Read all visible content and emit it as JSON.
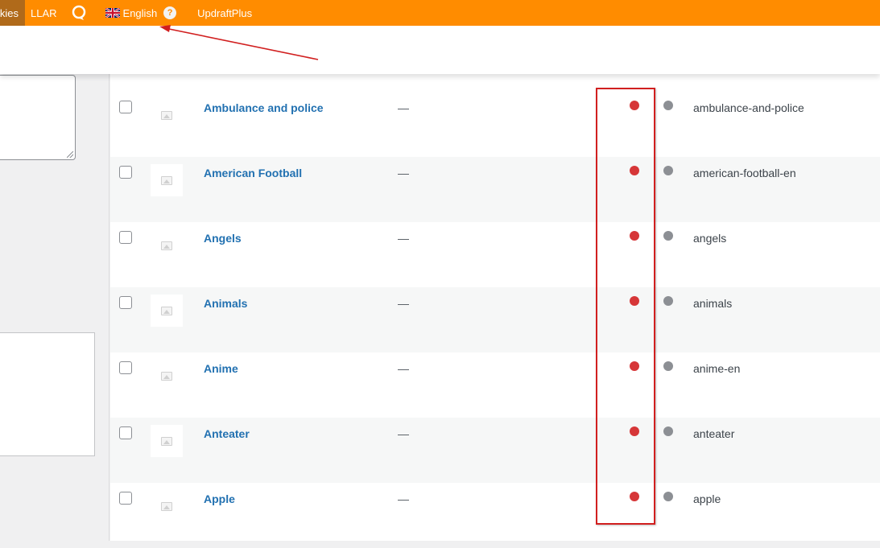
{
  "adminbar": {
    "cookies_label": "Cookies",
    "llar_label": "LLAR",
    "language_label": "English",
    "help_label": "?",
    "updraft_label": "UpdraftPlus",
    "icons": [
      "loop-icon",
      "uk-flag-icon",
      "help-icon"
    ]
  },
  "table": {
    "dash": "—",
    "rows": [
      {
        "name": "Ambulance and police",
        "slug": "ambulance-and-police"
      },
      {
        "name": "American Football",
        "slug": "american-football-en"
      },
      {
        "name": "Angels",
        "slug": "angels"
      },
      {
        "name": "Animals",
        "slug": "animals"
      },
      {
        "name": "Anime",
        "slug": "anime-en"
      },
      {
        "name": "Anteater",
        "slug": "anteater"
      },
      {
        "name": "Apple",
        "slug": "apple"
      }
    ]
  },
  "colors": {
    "adminbar_bg": "#ff8c00",
    "link": "#2271b1",
    "status_red": "#d63638",
    "status_grey": "#8c8f94",
    "annotation_red": "#d11f1f"
  }
}
